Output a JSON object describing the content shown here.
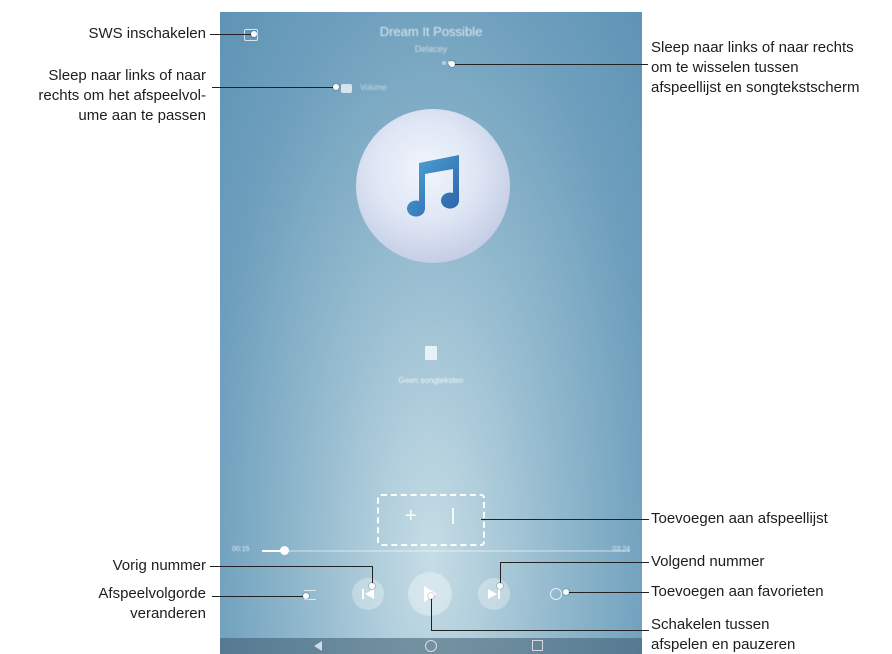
{
  "player": {
    "song_title": "Dream It Possible",
    "artist": "Delacey",
    "volume_label": "Volume",
    "lyrics_label": "Geen songteksten",
    "time_elapsed": "00:15",
    "time_total": "03:24",
    "progress": 0.06
  },
  "annotations": {
    "sws": "SWS inschakelen",
    "volume_line1": "Sleep naar links of naar",
    "volume_line2": "rechts om het afspeelvol-",
    "volume_line3": "ume aan te passen",
    "swipe_line1": "Sleep naar links of naar rechts",
    "swipe_line2": "om te wisselen tussen",
    "swipe_line3": "afspeellijst en songtekstscherm",
    "add_playlist": "Toevoegen aan afspeellijst",
    "prev": "Vorig nummer",
    "next": "Volgend nummer",
    "order_line1": "Afspeelvolgorde",
    "order_line2": "veranderen",
    "favorites": "Toevoegen aan favorieten",
    "playpause_line1": "Schakelen tussen",
    "playpause_line2": "afspelen en pauzeren"
  }
}
